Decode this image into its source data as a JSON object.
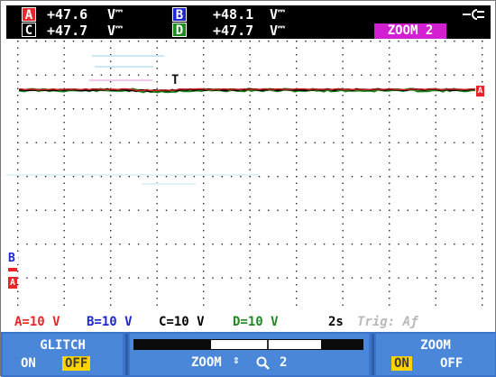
{
  "readout": {
    "channels": [
      {
        "id": "A",
        "value": "+47.6",
        "unit": "V",
        "color": "#e8262a",
        "text_color": "#ffffff"
      },
      {
        "id": "C",
        "value": "+47.7",
        "unit": "V",
        "color": "#000000",
        "text_color": "#ffffff"
      },
      {
        "id": "B",
        "value": "+48.1",
        "unit": "V",
        "color": "#1c27d0",
        "text_color": "#ffffff"
      },
      {
        "id": "D",
        "value": "+47.7",
        "unit": "V",
        "color": "#1f8a1f",
        "text_color": "#ffffff"
      }
    ],
    "zoom_badge": "ZOOM 2",
    "power_icon": "mains-plug-icon"
  },
  "markers": {
    "trigger": "T",
    "channel_B": "B",
    "channel_A": "A",
    "right_edge": "A"
  },
  "scale": {
    "A": "A=10 V",
    "B": "B=10 V",
    "C": "C=10 V",
    "D": "D=10 V",
    "time": "2s",
    "trigger": "Trig: Aƒ"
  },
  "softkeys": {
    "glitch": {
      "title": "GLITCH",
      "on": "ON",
      "off": "OFF",
      "selected": "OFF"
    },
    "zoom_control": {
      "label": "ZOOM",
      "level": "2"
    },
    "zoom": {
      "title": "ZOOM",
      "on": "ON",
      "off": "OFF",
      "selected": "ON"
    }
  },
  "colors": {
    "channel_A": "#e8262a",
    "channel_B": "#1c27d0",
    "channel_C": "#000000",
    "channel_D": "#1f8a1f",
    "softkey_bg": "#3b74c8",
    "selected_option": "#ffd200",
    "zoom_badge": "#d21fd2"
  }
}
